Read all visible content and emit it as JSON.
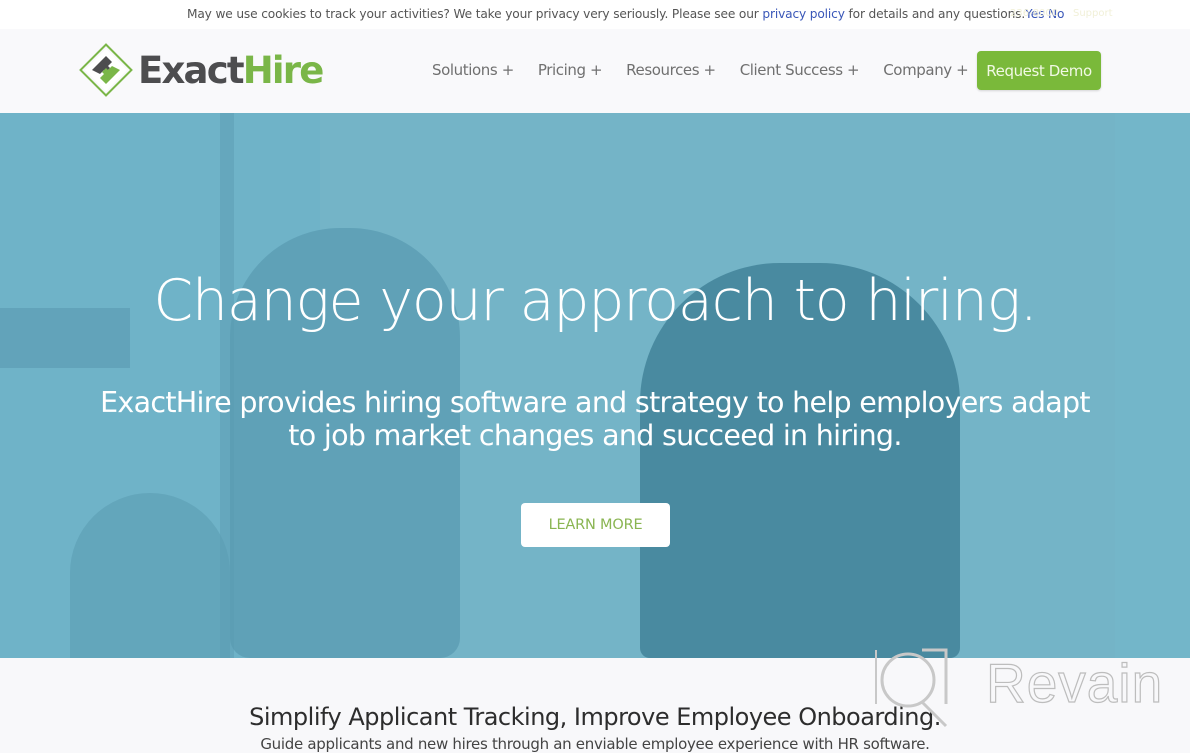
{
  "cookie_bar": {
    "message_before": "May we use cookies to track your activities? We take your privacy very seriously. Please see our ",
    "privacy_link": "privacy policy",
    "message_after": " for details and any questions.",
    "yes_label": "Yes",
    "no_label": "No",
    "faded_phone": "236-8000",
    "faded_support": "Support"
  },
  "header": {
    "logo": {
      "part1": "Exact",
      "part2": "Hire"
    },
    "nav": [
      {
        "label": "Solutions +"
      },
      {
        "label": "Pricing +"
      },
      {
        "label": "Resources +"
      },
      {
        "label": "Client Success +"
      },
      {
        "label": "Company +"
      }
    ],
    "cta_label": "Request Demo"
  },
  "hero": {
    "title": "Change your approach to hiring.",
    "subtitle_line1": "ExactHire provides hiring software and strategy to help employers adapt",
    "subtitle_line2": "to job market changes and succeed in hiring.",
    "button_label": "LEARN MORE"
  },
  "section": {
    "title": "Simplify Applicant Tracking, Improve Employee Onboarding.",
    "subtitle": "Guide applicants and new hires through an enviable employee experience with HR software."
  },
  "watermark": {
    "text": "Revain"
  },
  "colors": {
    "brand_green": "#7ab93a",
    "logo_gray": "#4d4d4f",
    "hero_tint": "#6fb3c8",
    "link_blue": "#3a57b8"
  }
}
